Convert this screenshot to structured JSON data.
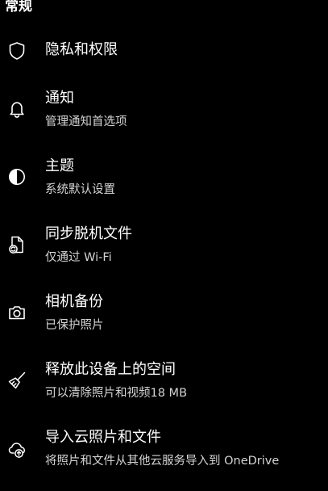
{
  "header": {
    "title": "常规"
  },
  "settings": [
    {
      "label": "隐私和权限",
      "sublabel": "",
      "icon": "shield-icon"
    },
    {
      "label": "通知",
      "sublabel": "管理通知首选项",
      "icon": "bell-icon"
    },
    {
      "label": "主题",
      "sublabel": "系统默认设置",
      "icon": "contrast-icon"
    },
    {
      "label": "同步脱机文件",
      "sublabel": "仅通过 Wi-Fi",
      "icon": "file-sync-icon"
    },
    {
      "label": "相机备份",
      "sublabel": "已保护照片",
      "icon": "camera-icon"
    },
    {
      "label": "释放此设备上的空间",
      "sublabel": "可以清除照片和视频18 MB",
      "icon": "broom-icon"
    },
    {
      "label": "导入云照片和文件",
      "sublabel": "将照片和文件从其他云服务导入到 OneDrive",
      "icon": "cloud-upload-icon"
    }
  ]
}
